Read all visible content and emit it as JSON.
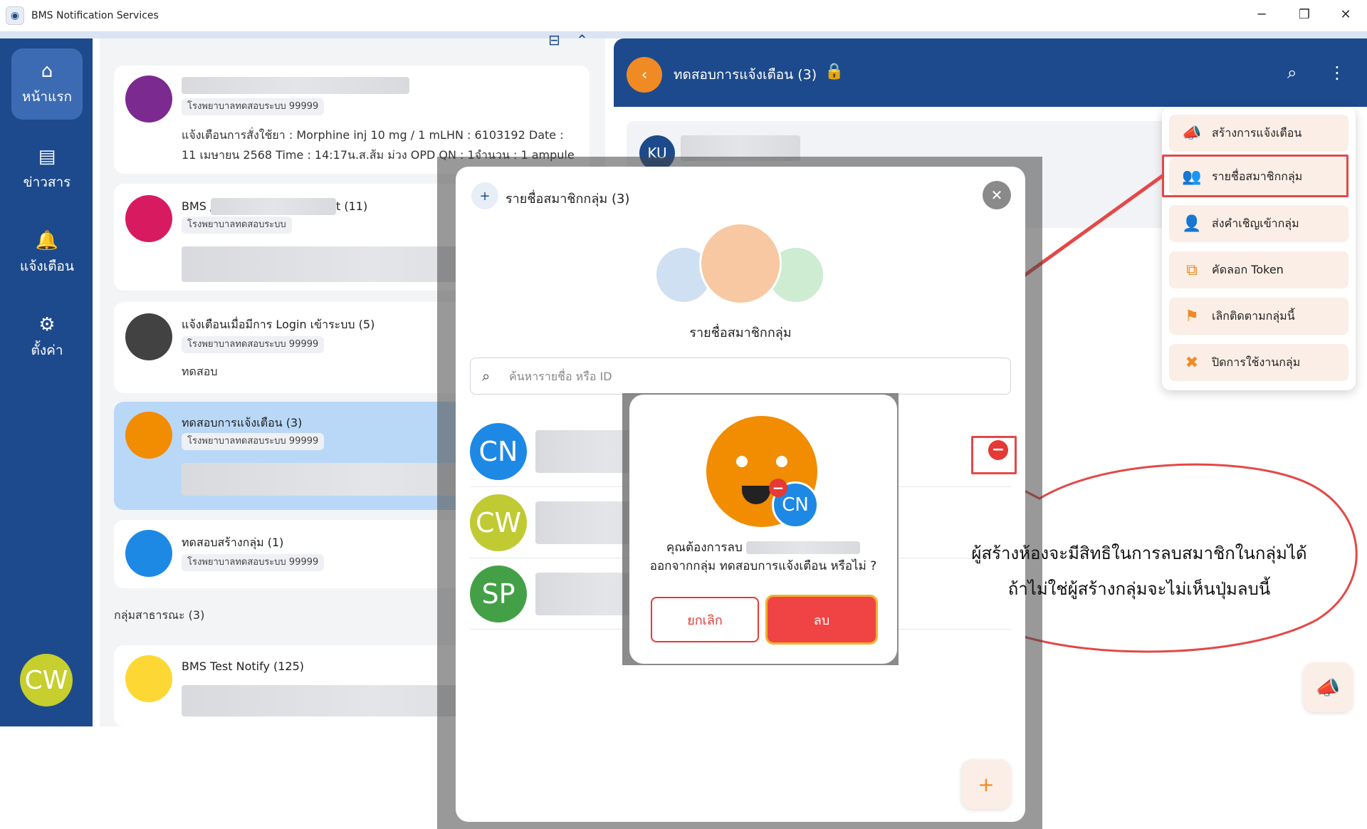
{
  "window": {
    "title": "BMS Notification Services",
    "controls": [
      "─",
      "❐",
      "✕"
    ]
  },
  "nav": {
    "items": [
      {
        "label": "หน้าแรก",
        "icon": "home-icon",
        "glyph": "⌂"
      },
      {
        "label": "ข่าวสาร",
        "icon": "news-icon",
        "glyph": "▤"
      },
      {
        "label": "แจ้งเตือน",
        "icon": "bell-icon",
        "glyph": "🔔"
      },
      {
        "label": "ตั้งค่า",
        "icon": "gear-icon",
        "glyph": "⚙"
      }
    ],
    "avatar": "CW"
  },
  "groups": [
    {
      "badge": "โรงพยาบาลทดสอบระบบ 99999",
      "message": "แจ้งเตือนการสั่งใช้ยา : Morphine inj 10 mg / 1 mLHN : 6103192 Date : 11 เมษายน 2568 Time : 14:17น.ส.ส้ม ม่วง OPD QN : 1จำนวน : 1 ampule"
    },
    {
      "name": "BMS /",
      "name_suffix": "t (11)",
      "badge": "โรงพยาบาลทดสอบระบบ"
    },
    {
      "name": "แจ้งเตือนเมื่อมีการ Login เข้าระบบ (5)",
      "badge": "โรงพยาบาลทดสอบระบบ 99999",
      "message": "ทดสอบ"
    },
    {
      "name": "ทดสอบการแจ้งเตือน (3)",
      "badge": "โรงพยาบาลทดสอบระบบ 99999"
    },
    {
      "name": "ทดสอบสร้างกลุ่ม (1)",
      "badge": "โรงพยาบาลทดสอบระบบ 99999"
    }
  ],
  "public_section_label": "กลุ่มสาธารณะ (3)",
  "public_groups": [
    {
      "name": "BMS Test Notify (125)"
    }
  ],
  "chat": {
    "title": "ทดสอบการแจ้งเตือน (3)",
    "first_avatar": "KU"
  },
  "menu": {
    "items": [
      {
        "label": "สร้างการแจ้งเตือน",
        "icon": "megaphone-icon",
        "glyph": "📣"
      },
      {
        "label": "รายชื่อสมาชิกกลุ่ม",
        "icon": "group-members-icon",
        "glyph": "👥"
      },
      {
        "label": "ส่งคำเชิญเข้ากลุ่ม",
        "icon": "invite-user-icon",
        "glyph": "👤"
      },
      {
        "label": "คัดลอก Token",
        "icon": "copy-icon",
        "glyph": "⧉"
      },
      {
        "label": "เลิกติดตามกลุ่มนี้",
        "icon": "unfollow-flag-icon",
        "glyph": "⚑"
      },
      {
        "label": "ปิดการใช้งานกลุ่ม",
        "icon": "disable-x-icon",
        "glyph": "✖"
      }
    ]
  },
  "modal": {
    "title": "รายชื่อสมาชิกกลุ่ม (3)",
    "subtitle": "รายชื่อสมาชิกกลุ่ม",
    "search_placeholder": "ค้นหารายชื่อ หรือ ID",
    "members": [
      {
        "initials": "CN",
        "color": "#1e88e5"
      },
      {
        "initials": "CW",
        "color": "#c0ca33"
      },
      {
        "initials": "SP",
        "color": "#43a047"
      }
    ]
  },
  "confirm": {
    "avatar": "CN",
    "line1": "คุณต้องการลบ",
    "line2": "ออกจากกลุ่ม ทดสอบการแจ้งเตือน หรือไม่ ?",
    "cancel_label": "ยกเลิก",
    "delete_label": "ลบ"
  },
  "callout": {
    "line1": "ผู้สร้างห้องจะมีสิทธิในการลบสมาชิกในกลุ่มได้",
    "line2": "ถ้าไม่ใช่ผู้สร้างกลุ่มจะไม่เห็นปุ่มลบนี้"
  },
  "colors": {
    "brand_blue": "#1d4a8c",
    "accent_orange": "#f08a24",
    "danger_red": "#e53935",
    "selected_card": "#b9d8f7"
  }
}
